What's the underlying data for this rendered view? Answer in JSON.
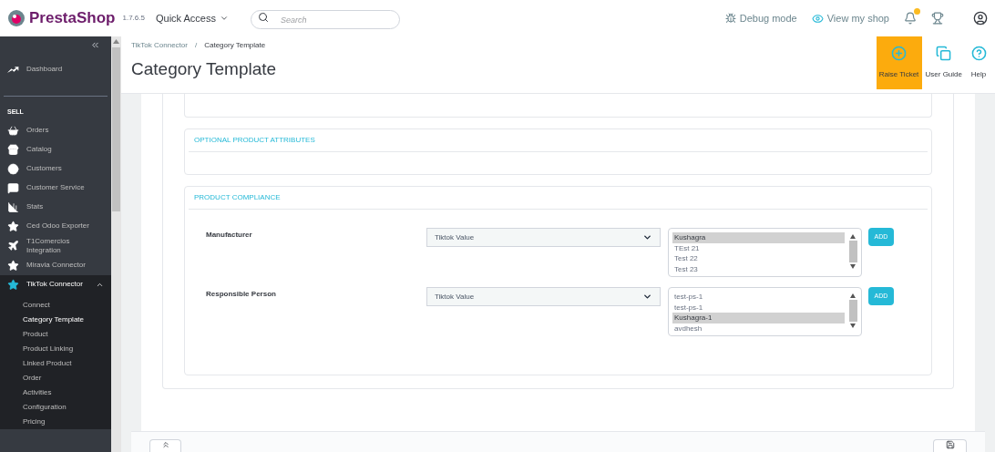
{
  "header": {
    "logo": "PrestaShop",
    "version": "1.7.6.5",
    "quick_access": "Quick Access",
    "search": {
      "placeholder": "Search"
    },
    "debug_mode": "Debug mode",
    "view_shop": "View my shop",
    "has_notification": true
  },
  "sidebar": {
    "items": [
      {
        "label": "Dashboard",
        "kind": "dashboard",
        "selected": false
      }
    ],
    "section": "SELL",
    "sell_items": [
      {
        "label": "Orders",
        "kind": "orders",
        "selected": false,
        "expanded": false
      },
      {
        "label": "Catalog",
        "kind": "catalog",
        "selected": false,
        "expanded": false
      },
      {
        "label": "Customers",
        "kind": "customers",
        "selected": false,
        "expanded": false
      },
      {
        "label": "Customer Service",
        "kind": "service",
        "selected": false,
        "expanded": false
      },
      {
        "label": "Stats",
        "kind": "stats",
        "selected": false,
        "expanded": false
      },
      {
        "label": "Ced Odoo Exporter",
        "kind": "star",
        "selected": false,
        "expanded": false
      },
      {
        "label": "T1Comercios Integration",
        "kind": "plane",
        "selected": false,
        "expanded": false
      },
      {
        "label": "Miravia Connector",
        "kind": "star",
        "selected": false,
        "expanded": false
      },
      {
        "label": "TikTok Connector",
        "kind": "star",
        "selected": true,
        "expanded": true,
        "children": [
          {
            "label": "Connect",
            "selected": false
          },
          {
            "label": "Category Template",
            "selected": true
          },
          {
            "label": "Product",
            "selected": false
          },
          {
            "label": "Product Linking",
            "selected": false
          },
          {
            "label": "Linked Product",
            "selected": false
          },
          {
            "label": "Order",
            "selected": false
          },
          {
            "label": "Activities",
            "selected": false
          },
          {
            "label": "Configuration",
            "selected": false
          },
          {
            "label": "Pricing",
            "selected": false
          }
        ]
      }
    ]
  },
  "breadcrumb": {
    "items": [
      "TikTok Connector",
      "Category Template"
    ],
    "separator": "/"
  },
  "page_title": "Category Template",
  "toolbar": [
    {
      "label": "Raise Ticket",
      "kind": "ticket",
      "highlighted": true
    },
    {
      "label": "User Guide",
      "kind": "guide",
      "highlighted": false
    },
    {
      "label": "Help",
      "kind": "help",
      "highlighted": false
    }
  ],
  "sections": [
    {
      "title": "OPTIONAL PRODUCT ATTRIBUTES"
    },
    {
      "title": "PRODUCT COMPLIANCE",
      "fields": [
        {
          "label": "Manufacturer",
          "select_value": "Tiktok Value",
          "options": [
            {
              "label": "Kushagra",
              "selected": true
            },
            {
              "label": "TEst 21",
              "selected": false
            },
            {
              "label": "Test 22",
              "selected": false
            },
            {
              "label": "Test 23",
              "selected": false
            }
          ],
          "button": "ADD"
        },
        {
          "label": "Responsible Person",
          "select_value": "Tiktok Value",
          "options": [
            {
              "label": "test-ps-1",
              "selected": false
            },
            {
              "label": "test-ps-1",
              "selected": false
            },
            {
              "label": "Kushagra-1",
              "selected": true
            },
            {
              "label": "avdhesh",
              "selected": false
            }
          ],
          "button": "ADD"
        }
      ]
    }
  ]
}
